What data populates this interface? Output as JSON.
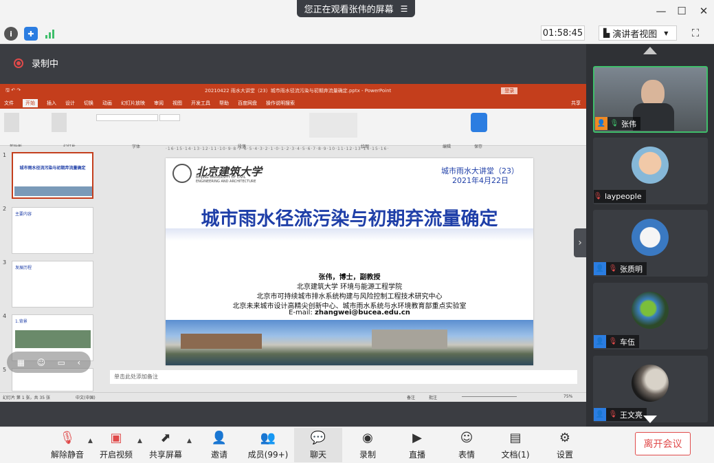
{
  "title_bar": {
    "share_banner": "您正在观看张伟的屏幕"
  },
  "toolbar": {
    "timer": "01:58:45",
    "view_mode": "演讲者视图"
  },
  "recording": {
    "label": "录制中"
  },
  "ppt": {
    "window_title": "20210422 雨水大讲堂（23）城市雨水径流污染与初期弃流量确定.pptx - PowerPoint",
    "login": "登录",
    "share": "共享",
    "tabs": [
      "文件",
      "开始",
      "插入",
      "设计",
      "切换",
      "动画",
      "幻灯片放映",
      "审阅",
      "视图",
      "开发工具",
      "帮助",
      "百度网盘",
      "操作说明搜索"
    ],
    "ribbon_groups": [
      "剪贴板",
      "幻灯片",
      "字体",
      "段落",
      "绘图",
      "编辑",
      "保存"
    ],
    "ruler": "·16·15·14·13·12·11·10·9·8·7·6·5·4·3·2·1·0·1·2·3·4·5·6·7·8·9·10·11·12·13·14·15·16·",
    "notes_placeholder": "单击此处添加备注",
    "status_left": "幻灯片 第 1 张，共 35 张",
    "status_lang": "中文(中国)",
    "status_notes": "备注",
    "status_comments": "批注",
    "zoom": "75%",
    "thumb_numbers": [
      "1",
      "2",
      "3",
      "4",
      "5"
    ],
    "thumb1_title": "城市雨水径流污染与初期弃流量确定",
    "thumb2_title": "主要内容",
    "thumb3_title": "发展历程",
    "thumb4_title": "1.背景"
  },
  "slide": {
    "university_name": "北京建筑大学",
    "university_en_1": "BEIJING UNIVERSITY OF CIVIL",
    "university_en_2": "ENGINEERING AND ARCHITECTURE",
    "lecture_series": "城市雨水大讲堂（23）",
    "date": "2021年4月22日",
    "main_title": "城市雨水径流污染与初期弃流量确定",
    "speaker": "张伟，博士，副教授",
    "affiliation_1": "北京建筑大学 环境与能源工程学院",
    "affiliation_2": "北京市可持续城市排水系统构建与风险控制工程技术研究中心",
    "affiliation_3": "北京未来城市设计高精尖创新中心、城市雨水系统与水环境教育部重点实验室",
    "email_label": "E-mail: ",
    "email": "zhangwei@bucea.edu.cn"
  },
  "participants": [
    {
      "name": "张伟",
      "mic": "on",
      "role": "host"
    },
    {
      "name": "laypeople",
      "mic": "muted",
      "role": "guest"
    },
    {
      "name": "张质明",
      "mic": "muted",
      "role": "member"
    },
    {
      "name": "车伍",
      "mic": "muted",
      "role": "member"
    },
    {
      "name": "王文亮",
      "mic": "muted",
      "role": "member"
    }
  ],
  "bottom_bar": {
    "unmute": "解除静音",
    "start_video": "开启视频",
    "share_screen": "共享屏幕",
    "invite": "邀请",
    "members": "成员(99+)",
    "chat": "聊天",
    "record": "录制",
    "live": "直播",
    "reactions": "表情",
    "docs": "文档(1)",
    "settings": "设置",
    "leave": "离开会议"
  },
  "colors": {
    "ppt_accent": "#c43e1c",
    "slide_title": "#1f3fa8",
    "leave_red": "#e04a4a",
    "active_speaker": "#3fbf6b"
  }
}
